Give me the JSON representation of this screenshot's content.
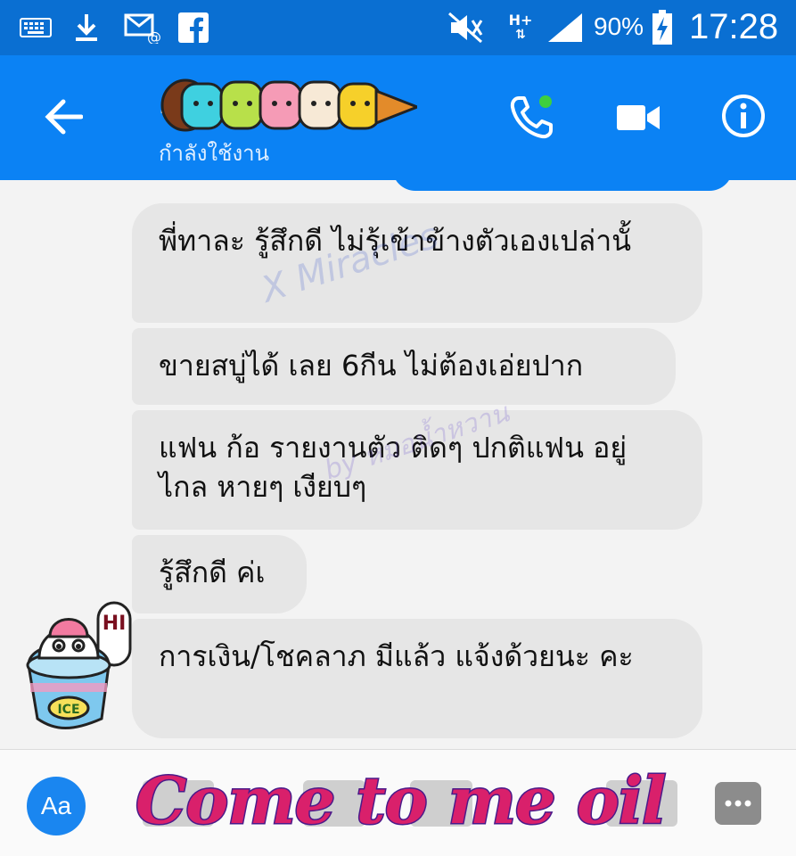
{
  "status_bar": {
    "icons": [
      "keyboard-icon",
      "download-icon",
      "email-icon",
      "facebook-icon",
      "mute-icon",
      "network-icon",
      "signal-icon",
      "battery-icon"
    ],
    "network_type": "H+",
    "battery_percent": "90%",
    "time": "17:28"
  },
  "header": {
    "title": "...oo...",
    "status": "กำลังใช้งาน"
  },
  "messages": [
    {
      "text": "พี่ทาละ รู้สึกดี ไม่รุ้เข้าข้างตัวเองเปล่านั้"
    },
    {
      "text": "ขายสบู่ได้ เลย 6กีน ไม่ต้องเอ่ยปาก"
    },
    {
      "text": "แฟน ก้อ รายงานตัว ติดๆ ปกติแฟน อยู่ไกล หายๆ เงียบๆ"
    },
    {
      "text": "รู้สึกดี ค่เ"
    },
    {
      "text": "การเงิน/โชคลาภ มีแล้ว แจ้งด้วยนะ คะ"
    }
  ],
  "watermarks": {
    "top": "X Miracles",
    "middle": "by หมอน้ำหวาน"
  },
  "avatar": {
    "sticker_text": "ICE",
    "bubble_text": "HI"
  },
  "composer": {
    "aa_label": "Aa",
    "overlay_caption": "Come to me oil"
  },
  "colors": {
    "status_bar": "#0a6fd2",
    "header": "#0b82f4",
    "bubble": "#e6e6e6",
    "caption": "#d9206b"
  }
}
